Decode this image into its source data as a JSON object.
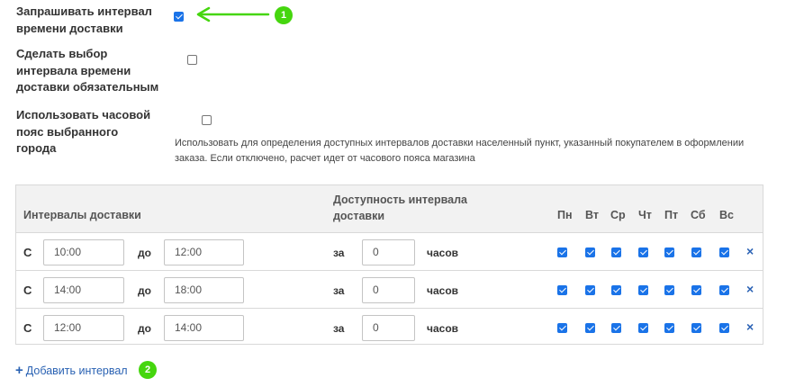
{
  "settings": [
    {
      "label": "Запрашивать интервал времени доставки",
      "checked": true
    },
    {
      "label": "Сделать выбор интервала времени доставки обязательным",
      "checked": false
    },
    {
      "label": "Использовать часовой пояс выбранного города",
      "checked": false
    }
  ],
  "timezone_hint": "Использовать для определения доступных интервалов доставки населенный пункт, указанный покупателем в оформлении заказа. Если отключено, расчет идет от часового пояса магазина",
  "markers": {
    "first": "1",
    "second": "2"
  },
  "table": {
    "header_intervals": "Интервалы доставки",
    "header_availability": "Доступность интервала доставки",
    "days": [
      "Пн",
      "Вт",
      "Ср",
      "Чт",
      "Пт",
      "Сб",
      "Вс"
    ],
    "rows": [
      {
        "prefix": "С",
        "from": "10:00",
        "to_label": "до",
        "to": "12:00",
        "in_label": "за",
        "hours": "0",
        "hours_label": "часов",
        "days_checked": [
          true,
          true,
          true,
          true,
          true,
          true,
          true
        ],
        "delete_icon": "×"
      },
      {
        "prefix": "С",
        "from": "14:00",
        "to_label": "до",
        "to": "18:00",
        "in_label": "за",
        "hours": "0",
        "hours_label": "часов",
        "days_checked": [
          true,
          true,
          true,
          true,
          true,
          true,
          true
        ],
        "delete_icon": "×"
      },
      {
        "prefix": "С",
        "from": "12:00",
        "to_label": "до",
        "to": "14:00",
        "in_label": "за",
        "hours": "0",
        "hours_label": "часов",
        "days_checked": [
          true,
          true,
          true,
          true,
          true,
          true,
          true
        ],
        "delete_icon": "×"
      }
    ]
  },
  "add_interval": {
    "icon": "+",
    "label": "Добавить интервал"
  },
  "colors": {
    "accent": "#1a73e8",
    "link": "#2a62b3",
    "marker": "#45d60e"
  }
}
